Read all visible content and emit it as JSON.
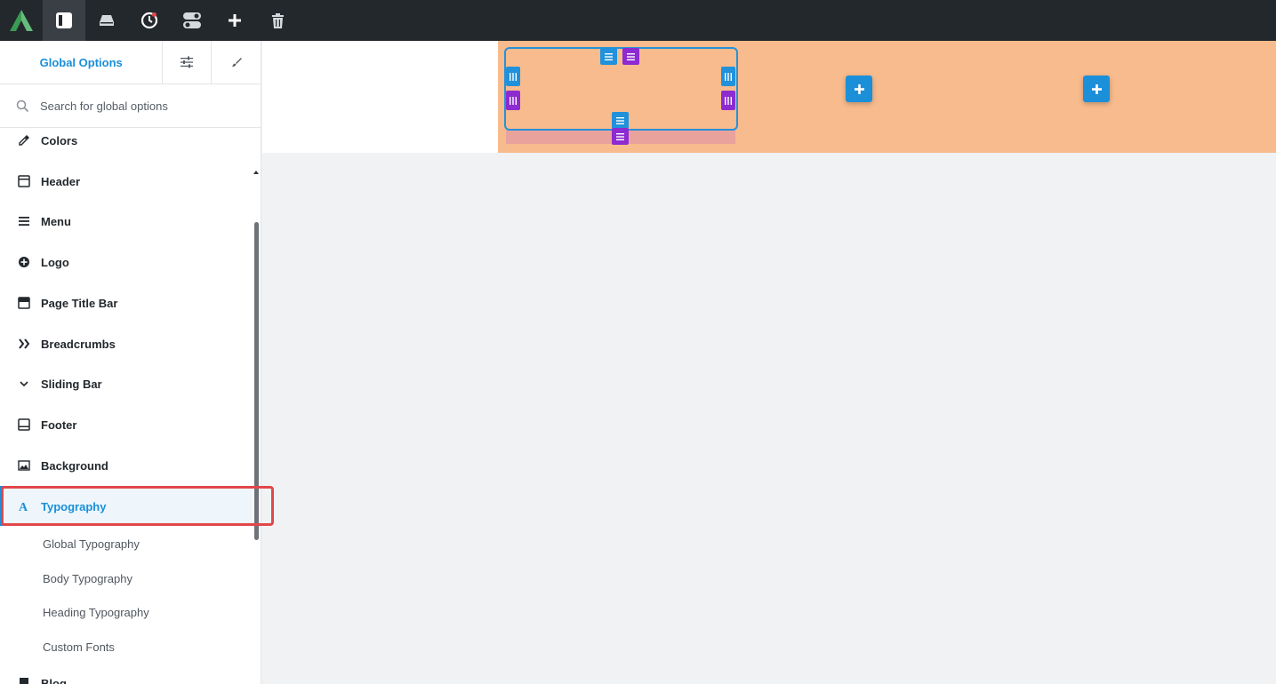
{
  "toolbar": {
    "logo": "avada-logo-icon",
    "buttons": [
      {
        "icon": "sidebar-panel-icon",
        "active": true
      },
      {
        "icon": "drive-icon"
      },
      {
        "icon": "history-clock-icon"
      },
      {
        "icon": "toggles-icon"
      },
      {
        "icon": "plus-icon"
      },
      {
        "icon": "trash-icon"
      }
    ]
  },
  "sidebar": {
    "tab_main": "Global Options",
    "tab_icons": [
      "sliders-icon",
      "paint-brush-icon"
    ],
    "search_placeholder": "Search for global options",
    "items": [
      {
        "label": "Colors",
        "icon": "eyedropper-icon"
      },
      {
        "label": "Header",
        "icon": "header-layout-icon"
      },
      {
        "label": "Menu",
        "icon": "hamburger-icon"
      },
      {
        "label": "Logo",
        "icon": "plus-circle-icon"
      },
      {
        "label": "Page Title Bar",
        "icon": "title-bar-icon"
      },
      {
        "label": "Breadcrumbs",
        "icon": "double-chevron-icon"
      },
      {
        "label": "Sliding Bar",
        "icon": "chevron-down-icon"
      },
      {
        "label": "Footer",
        "icon": "footer-layout-icon"
      },
      {
        "label": "Background",
        "icon": "image-icon"
      },
      {
        "label": "Typography",
        "icon": "typography-icon",
        "active": true
      },
      {
        "label": "Blog",
        "icon": "blog-icon"
      }
    ],
    "sub_items": [
      "Global Typography",
      "Body Typography",
      "Heading Typography",
      "Custom Fonts"
    ]
  },
  "colors": {
    "accent": "#198fd9",
    "toolbar_bg": "#23282d",
    "canvas_orange": "#f8bb8d",
    "highlight": "#e2474a",
    "purple": "#8d2bd0"
  }
}
